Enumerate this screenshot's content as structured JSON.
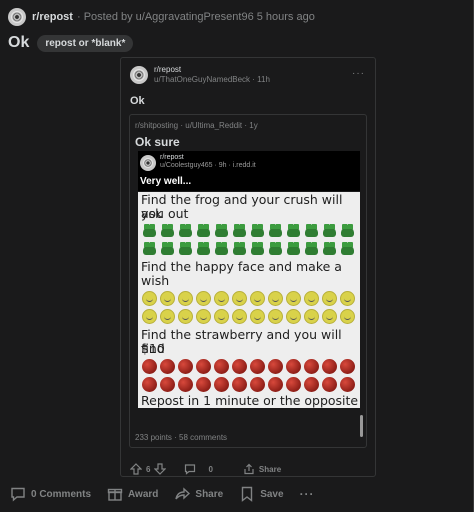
{
  "post": {
    "subreddit": "r/repost",
    "posted_by": "· Posted by u/AggravatingPresent96 5 hours ago",
    "title": "Ok",
    "flair": "repost or *blank*"
  },
  "embed": {
    "subreddit": "r/repost",
    "author_line": "u/ThatOneGuyNamedBeck · 11h",
    "more": "···",
    "title": "Ok",
    "crosspost": {
      "meta": "r/shitposting · u/Ultima_Reddit · 1y",
      "title": "Ok sure",
      "nested": {
        "subreddit": "r/repost",
        "meta": "u/Coolestguy465 · 9h · i.redd.it",
        "title": "Very well..."
      },
      "meme_lines": [
        "Find the frog and your crush will ask",
        "you out",
        "Find the happy face and make a",
        "wish",
        "Find the strawberry and you will find",
        "$10",
        "Repost in 1 minute or the opposite"
      ],
      "footer": "233 points · 58 comments"
    },
    "actions": {
      "vote_count": "6",
      "comment_count": "0",
      "share_label": "Share"
    }
  },
  "actions": {
    "comments": "0 Comments",
    "award": "Award",
    "share": "Share",
    "save": "Save",
    "more": "···"
  }
}
